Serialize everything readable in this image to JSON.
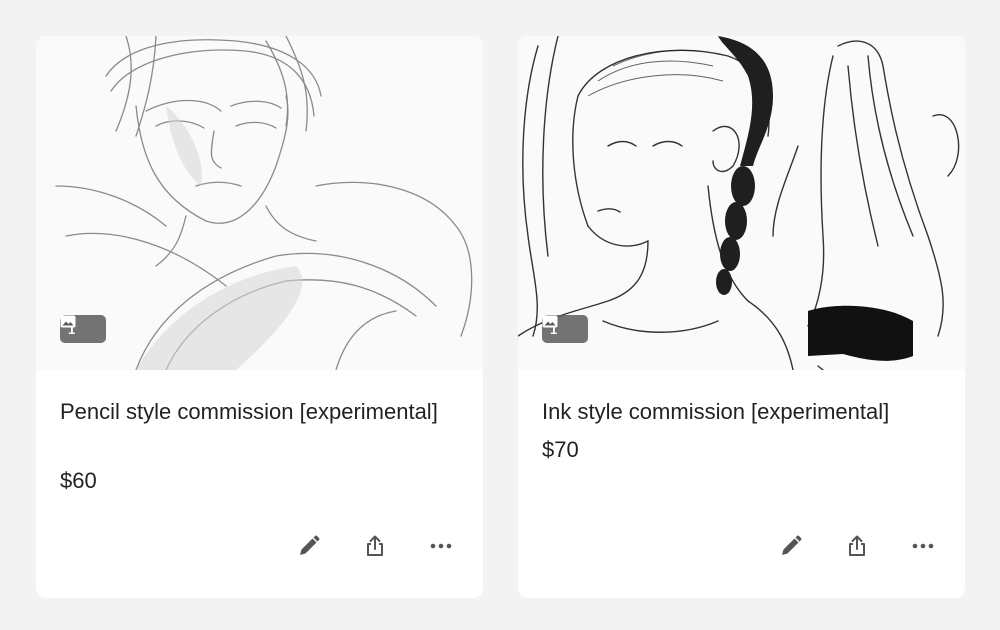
{
  "listings": [
    {
      "title": "Pencil style commission [experimental]",
      "price": "$60",
      "photo_count": "1",
      "thumbnail_subject": "pencil-sketch-man",
      "actions": [
        "edit-icon",
        "share-icon",
        "more-icon"
      ]
    },
    {
      "title": "Ink style commission [experimental]",
      "price": "$70",
      "photo_count": "1",
      "thumbnail_subject": "ink-sketch-girls",
      "actions": [
        "edit-icon",
        "share-icon",
        "more-icon"
      ]
    }
  ],
  "colors": {
    "page_background": "#f3f3f3",
    "card_background": "#ffffff",
    "text": "#222222",
    "icon": "#555555",
    "badge_background": "#5a5a5a"
  }
}
